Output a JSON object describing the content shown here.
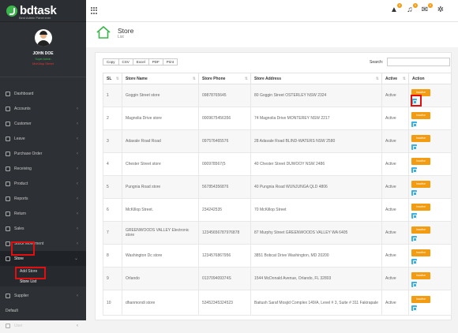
{
  "brand": {
    "name": "bdtask",
    "tagline": "Best Admin Panel ever"
  },
  "profile": {
    "name": "JOHN DOE",
    "role": "Super Admin",
    "store": "McKillop Street"
  },
  "nav": [
    {
      "label": "Dashboard"
    },
    {
      "label": "Accounts"
    },
    {
      "label": "Customer"
    },
    {
      "label": "Leave"
    },
    {
      "label": "Purchase Order"
    },
    {
      "label": "Receiving"
    },
    {
      "label": "Product"
    },
    {
      "label": "Reports"
    },
    {
      "label": "Return"
    },
    {
      "label": "Sales"
    },
    {
      "label": "Stock Movement"
    },
    {
      "label": "Store"
    },
    {
      "label": "Supplier"
    },
    {
      "label": "Default"
    },
    {
      "label": "User"
    }
  ],
  "store_sub": {
    "add": "Add Store",
    "list": "Store List"
  },
  "topbar": {
    "notif_count": "0",
    "alert_count": "0",
    "mail_count": "0"
  },
  "page": {
    "title": "Store",
    "subtitle": "List"
  },
  "tools": {
    "buttons": [
      "Copy",
      "CSV",
      "Excel",
      "PDF",
      "Print"
    ],
    "search_label": "Search:"
  },
  "table": {
    "headers": [
      "SL",
      "Store Name",
      "Store Phone",
      "Store Address",
      "Active",
      "Action"
    ],
    "action_label": "Inactive",
    "rows": [
      {
        "sl": "1",
        "name": "Goggin Street store",
        "phone": "09878765645",
        "address": "80 Goggin Street OSTERLEY NSW 2324",
        "active": "Active"
      },
      {
        "sl": "2",
        "name": "Magnolia Drive store",
        "phone": "0009675456356",
        "address": "74 Magnolia Drive MONTEREY NSW 2217",
        "active": "Active"
      },
      {
        "sl": "3",
        "name": "Adavale Road Road",
        "phone": "097576465576",
        "address": "28 Adavale Road BLIND-WATERS NSW 2580",
        "active": "Active"
      },
      {
        "sl": "4",
        "name": "Chester Street store",
        "phone": "000978567(5",
        "address": "40 Chester Street DUWOOY NSW 2486",
        "active": "Active"
      },
      {
        "sl": "5",
        "name": "Pungnia Road store",
        "phone": "567854356876",
        "address": "40 Pungnia Road WUNJUNGA QLD 4806",
        "active": "Active"
      },
      {
        "sl": "6",
        "name": "McKillop Street.",
        "phone": "234242535",
        "address": "70 McKillop Street",
        "active": "Active"
      },
      {
        "sl": "7",
        "name": "GREENWOODS VALLEY Electronic store",
        "phone": "12345656787976878",
        "address": "87 Murphy Street GREENWOODS VALLEY WA 6405",
        "active": "Active"
      },
      {
        "sl": "8",
        "name": "Washington Dc store",
        "phone": "1234576867956",
        "address": "3851 Bobcat Drive Washington, MD 20200",
        "active": "Active"
      },
      {
        "sl": "9",
        "name": "Orlando",
        "phone": "013709409374S",
        "address": "1544 McDonald Avenue, Orlando, FL 32803",
        "active": "Active"
      },
      {
        "sl": "10",
        "name": "dhanmondi store",
        "phone": "53452345324523",
        "address": "Baitush Saraf Mosjid Complex 149/A, Level # 3, Suite # 311 Fakirapale",
        "active": "Active"
      }
    ]
  },
  "colors": {
    "sidebar": "#2d3035",
    "accent_green": "#39b54a",
    "inactive": "#f39c12",
    "edit": "#3bb0e3",
    "highlight": "#e01010"
  }
}
